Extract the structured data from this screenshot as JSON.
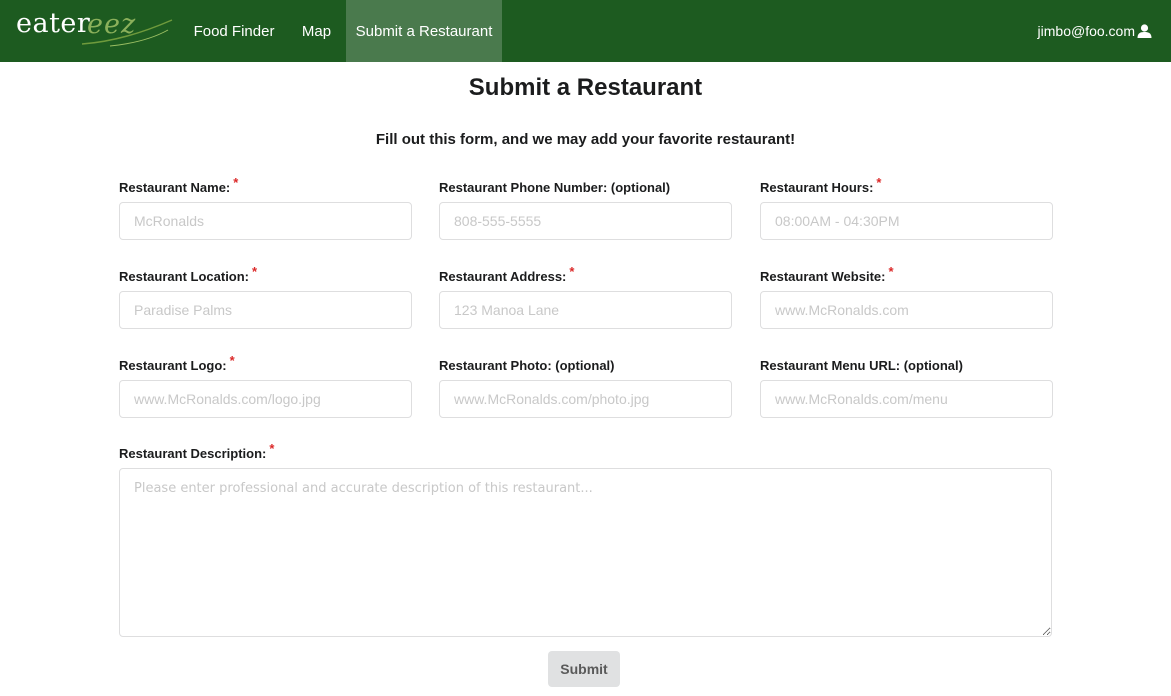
{
  "brand": {
    "part1": "eater",
    "part2": "eez"
  },
  "nav": {
    "items": [
      {
        "label": "Food Finder"
      },
      {
        "label": "Map"
      },
      {
        "label": "Submit a Restaurant"
      }
    ],
    "user": "jimbo@foo.com"
  },
  "page": {
    "title": "Submit a Restaurant",
    "subtitle": "Fill out this form, and we may add your favorite restaurant!"
  },
  "form": {
    "required_mark": "*",
    "name": {
      "label": "Restaurant Name:",
      "placeholder": "McRonalds",
      "value": ""
    },
    "phone": {
      "label": "Restaurant Phone Number: (optional)",
      "placeholder": "808-555-5555",
      "value": ""
    },
    "hours": {
      "label": "Restaurant Hours:",
      "placeholder": "08:00AM - 04:30PM",
      "value": ""
    },
    "location": {
      "label": "Restaurant Location:",
      "placeholder": "Paradise Palms",
      "value": ""
    },
    "address": {
      "label": "Restaurant Address:",
      "placeholder": "123 Manoa Lane",
      "value": ""
    },
    "website": {
      "label": "Restaurant Website:",
      "placeholder": "www.McRonalds.com",
      "value": ""
    },
    "logo": {
      "label": "Restaurant Logo:",
      "placeholder": "www.McRonalds.com/logo.jpg",
      "value": ""
    },
    "photo": {
      "label": "Restaurant Photo: (optional)",
      "placeholder": "www.McRonalds.com/photo.jpg",
      "value": ""
    },
    "menu": {
      "label": "Restaurant Menu URL: (optional)",
      "placeholder": "www.McRonalds.com/menu",
      "value": ""
    },
    "description": {
      "label": "Restaurant Description:",
      "placeholder": "Please enter professional and accurate description of this restaurant...",
      "value": ""
    },
    "submit_label": "Submit"
  },
  "colors": {
    "navbar": "#1d5b20",
    "nav_active": "#4a7a4d",
    "required": "#db2828",
    "submit_bg": "#e0e1e2"
  },
  "icons": {
    "user": "user-icon"
  }
}
